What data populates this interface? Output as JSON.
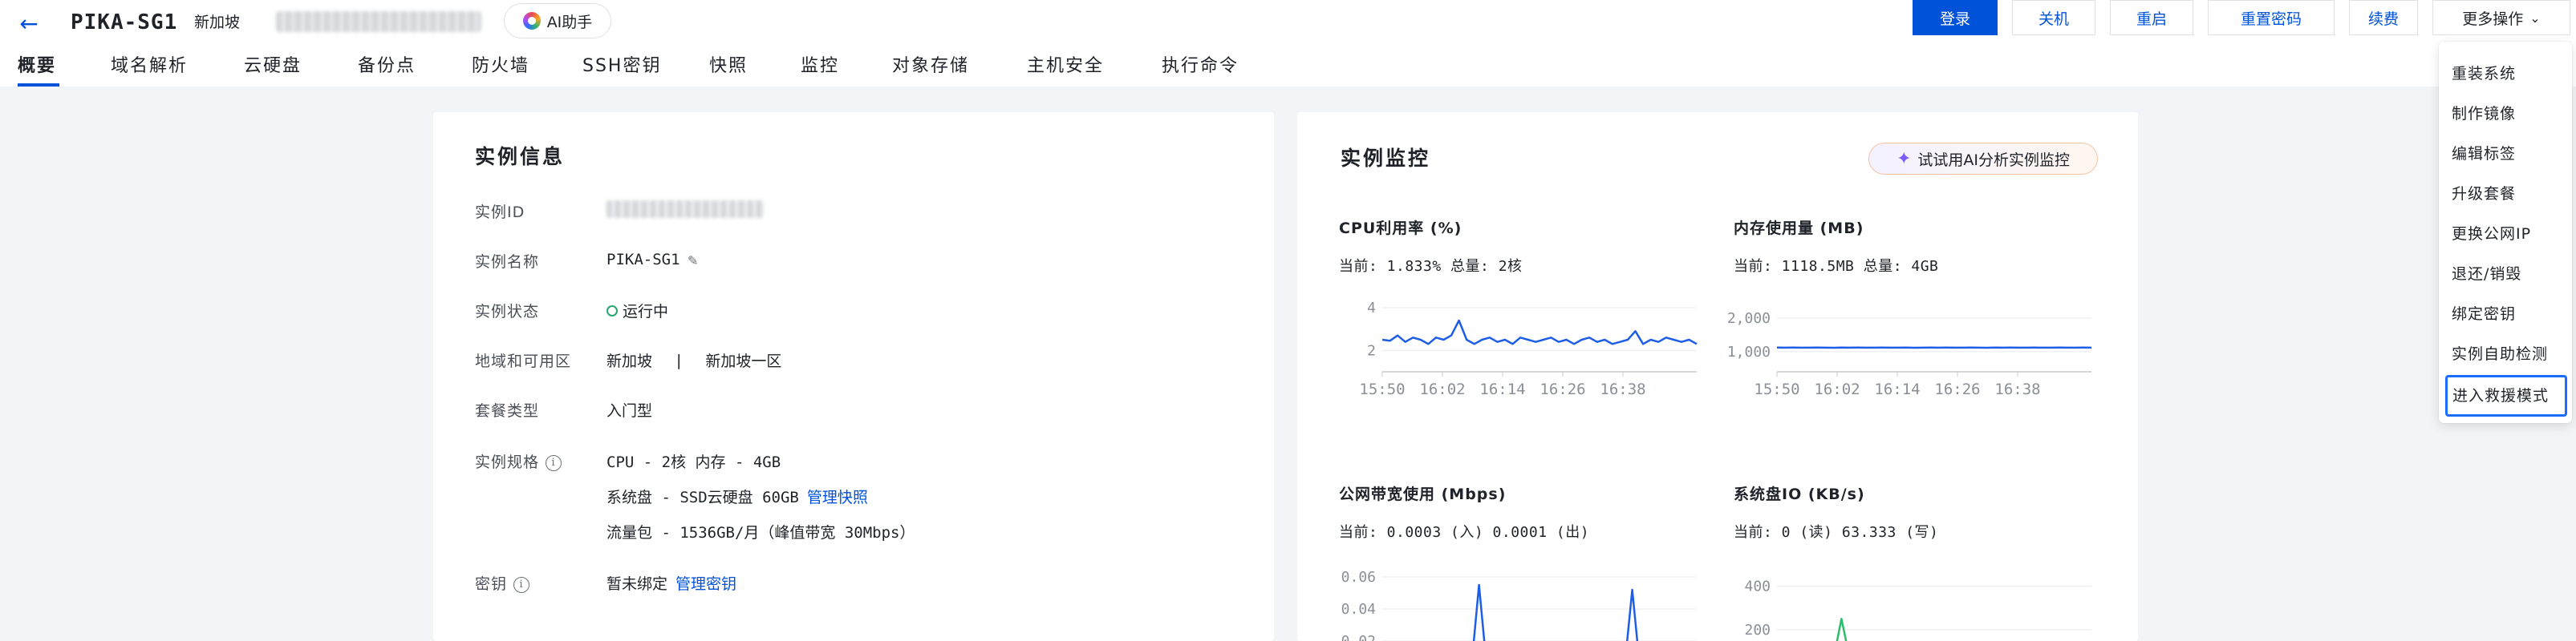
{
  "header": {
    "back_icon": "arrow-left-icon",
    "title": "PIKA-SG1",
    "region": "新加坡",
    "ai_assistant": "AI助手",
    "actions": {
      "login": "登录",
      "shutdown": "关机",
      "restart": "重启",
      "reset_password": "重置密码",
      "renew": "续费",
      "more": "更多操作"
    }
  },
  "tabs": [
    "概要",
    "域名解析",
    "云硬盘",
    "备份点",
    "防火墙",
    "SSH密钥",
    "快照",
    "监控",
    "对象存储",
    "主机安全",
    "执行命令"
  ],
  "active_tab": "概要",
  "instance_info": {
    "title": "实例信息",
    "labels": {
      "id": "实例ID",
      "name": "实例名称",
      "status": "实例状态",
      "zone": "地域和可用区",
      "package": "套餐类型",
      "spec": "实例规格",
      "key": "密钥"
    },
    "name": "PIKA-SG1",
    "status": "运行中",
    "region": "新加坡",
    "zone_sep": "|",
    "zone": "新加坡一区",
    "package": "入门型",
    "spec_cpu": "CPU - 2核 内存 - 4GB",
    "spec_disk": "系统盘 - SSD云硬盘 60GB",
    "manage_snapshot": "管理快照",
    "spec_traffic": "流量包 - 1536GB/月（峰值带宽 30Mbps）",
    "key_status": "暂未绑定",
    "manage_key": "管理密钥"
  },
  "monitor": {
    "title": "实例监控",
    "ai_analyze": "试试用AI分析实例监控",
    "time_ticks": [
      "15:50",
      "16:02",
      "16:14",
      "16:26",
      "16:38"
    ],
    "panels": {
      "cpu": {
        "title": "CPU利用率 (%)",
        "summary": "当前: 1.833% 总量: 2核",
        "y_ticks": [
          "4",
          "2"
        ]
      },
      "mem": {
        "title": "内存使用量 (MB)",
        "summary": "当前: 1118.5MB 总量: 4GB",
        "y_ticks": [
          "2,000",
          "1,000"
        ]
      },
      "net": {
        "title": "公网带宽使用 (Mbps)",
        "summary": "当前: 0.0003 (入) 0.0001 (出)",
        "y_ticks": [
          "0.06",
          "0.04",
          "0.02"
        ]
      },
      "io": {
        "title": "系统盘IO (KB/s)",
        "summary": "当前: 0 (读) 63.333 (写)",
        "y_ticks": [
          "400",
          "200"
        ]
      }
    },
    "colors": {
      "line_blue": "#1e5ee6",
      "line_green": "#2ebd6c"
    }
  },
  "more_menu": {
    "items": [
      "重装系统",
      "制作镜像",
      "编辑标签",
      "升级套餐",
      "更换公网IP",
      "退还/销毁",
      "绑定密钥",
      "实例自助检测",
      "进入救援模式"
    ],
    "selected": "进入救援模式"
  },
  "chart_data": [
    {
      "type": "line",
      "title": "CPU利用率 (%)",
      "x": [
        "15:50",
        "16:02",
        "16:14",
        "16:26",
        "16:38"
      ],
      "ylim": [
        1,
        4.3
      ],
      "series": [
        {
          "values": [
            2.5,
            2.45,
            2.7,
            2.4,
            2.6,
            2.5,
            2.3,
            2.6,
            2.5,
            2.7,
            3.4,
            2.5,
            2.3,
            2.5,
            2.6,
            2.4,
            2.5,
            2.3,
            2.6,
            2.5,
            2.4,
            2.5,
            2.6,
            2.4,
            2.5,
            2.3,
            2.5,
            2.6,
            2.4,
            2.5,
            2.3,
            2.4,
            2.5,
            2.9,
            2.3,
            2.5,
            2.4,
            2.6,
            2.5,
            2.4,
            2.5,
            2.3
          ]
        }
      ]
    },
    {
      "type": "line",
      "title": "内存使用量 (MB)",
      "x": [
        "15:50",
        "16:02",
        "16:14",
        "16:26",
        "16:38"
      ],
      "ylim": [
        400,
        2500
      ],
      "series": [
        {
          "values": [
            1120,
            1118,
            1121,
            1119,
            1118,
            1120,
            1119,
            1117,
            1120,
            1118,
            1121,
            1119,
            1118,
            1120,
            1119,
            1118,
            1120,
            1117,
            1119,
            1121,
            1118,
            1120,
            1119,
            1118,
            1120,
            1119,
            1117,
            1120,
            1118,
            1121,
            1119,
            1118,
            1120,
            1119,
            1118,
            1120,
            1118,
            1119,
            1120,
            1118
          ]
        }
      ]
    },
    {
      "type": "line",
      "title": "公网带宽使用 (Mbps)",
      "ylim": [
        0,
        0.065
      ],
      "series": [
        {
          "values": [
            0.001,
            0.001,
            0.002,
            0.001,
            0.001,
            0.002,
            0.001,
            0.001,
            0.001,
            0.002,
            0.001,
            0.001,
            0.055,
            0.001,
            0.001,
            0.001,
            0.002,
            0.001,
            0.001,
            0.001,
            0.002,
            0.001,
            0.001,
            0.001,
            0.002,
            0.001,
            0.001,
            0.001,
            0.001,
            0.002,
            0.001,
            0.052,
            0.001,
            0.001,
            0.001,
            0.002,
            0.001,
            0.001,
            0.001,
            0.001
          ]
        },
        {
          "values": [
            0.001,
            0.001,
            0.001,
            0.002,
            0.001,
            0.001,
            0.001,
            0.001,
            0.002,
            0.001,
            0.001,
            0.001,
            0.003,
            0.001,
            0.001,
            0.012,
            0.001,
            0.001,
            0.001,
            0.001,
            0.002,
            0.001,
            0.001,
            0.001,
            0.001,
            0.001,
            0.002,
            0.001,
            0.001,
            0.001,
            0.001,
            0.001,
            0.002,
            0.001,
            0.001,
            0.001,
            0.001,
            0.002,
            0.001,
            0.001
          ]
        }
      ]
    },
    {
      "type": "line",
      "title": "系统盘IO (KB/s)",
      "ylim": [
        0,
        480
      ],
      "series": [
        {
          "values": [
            0,
            0,
            60,
            55,
            62,
            58,
            60,
            64,
            250,
            70,
            58,
            62,
            60,
            58,
            75,
            60,
            62,
            58,
            60,
            61,
            59,
            62,
            60,
            58,
            61,
            60,
            62,
            59,
            60,
            61,
            58,
            62,
            60,
            59,
            61,
            60,
            62,
            58,
            60,
            63
          ]
        }
      ]
    }
  ]
}
